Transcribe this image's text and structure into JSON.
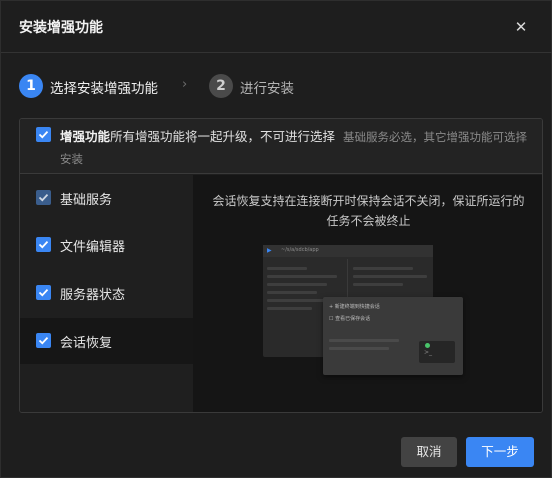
{
  "dialog": {
    "title": "安装增强功能",
    "close_icon": "close-icon"
  },
  "steps": [
    {
      "number": "1",
      "label": "选择安装增强功能"
    },
    {
      "number": "2",
      "label": "进行安装"
    }
  ],
  "header": {
    "strong": "增强功能",
    "text": "所有增强功能将一起升级，不可进行选择",
    "note": "基础服务必选，其它增强功能可选择安装"
  },
  "features": [
    {
      "label": "基础服务",
      "checked": true,
      "disabled": true
    },
    {
      "label": "文件编辑器",
      "checked": true
    },
    {
      "label": "服务器状态",
      "checked": true
    },
    {
      "label": "会话恢复",
      "checked": true,
      "active": true
    }
  ],
  "detail": {
    "description": "会话恢复支持在连接断开时保持会话不关闭，保证所运行的任务不会被终止"
  },
  "illustration": {
    "tab_text": "~/s/a/sdcb/app",
    "row1": "+ 新建终端到快捷会话",
    "row2": "☐ 查看已保存会话"
  },
  "buttons": {
    "cancel": "取消",
    "next": "下一步"
  },
  "colors": {
    "accent": "#3a86f3",
    "background": "#1e1e1e"
  }
}
